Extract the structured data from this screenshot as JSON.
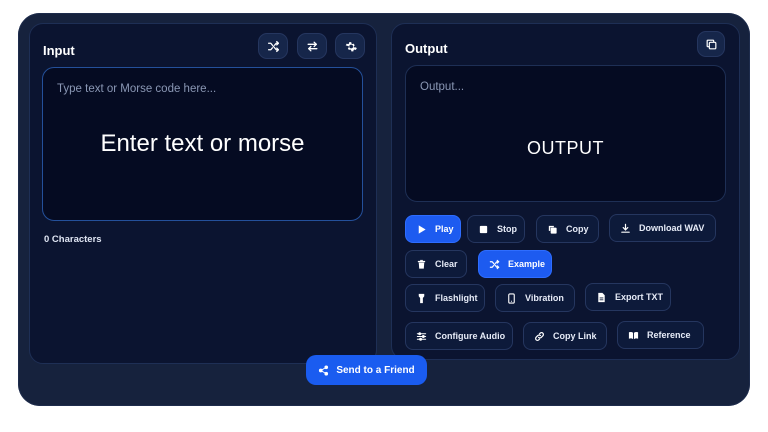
{
  "input": {
    "title": "Input",
    "placeholder": "Type text or Morse code here...",
    "display_text": "Enter text or morse",
    "char_count": "0 Characters",
    "icons": [
      "shuffle-icon",
      "swap-icon",
      "gear-icon"
    ]
  },
  "output": {
    "title": "Output",
    "placeholder": "Output...",
    "display_text": "OUTPUT",
    "icons": [
      "copy-icon"
    ]
  },
  "buttons": {
    "play": "Play",
    "stop": "Stop",
    "copy": "Copy",
    "download_wav": "Download WAV",
    "clear": "Clear",
    "example": "Example",
    "flashlight": "Flashlight",
    "vibration": "Vibration",
    "export_txt": "Export TXT",
    "configure_audio": "Configure Audio",
    "copy_link": "Copy Link",
    "reference": "Reference"
  },
  "footer": {
    "send_label": "Send to a Friend"
  },
  "colors": {
    "accent": "#1d5bf0",
    "panel": "#0b1430",
    "background": "#16223d"
  }
}
